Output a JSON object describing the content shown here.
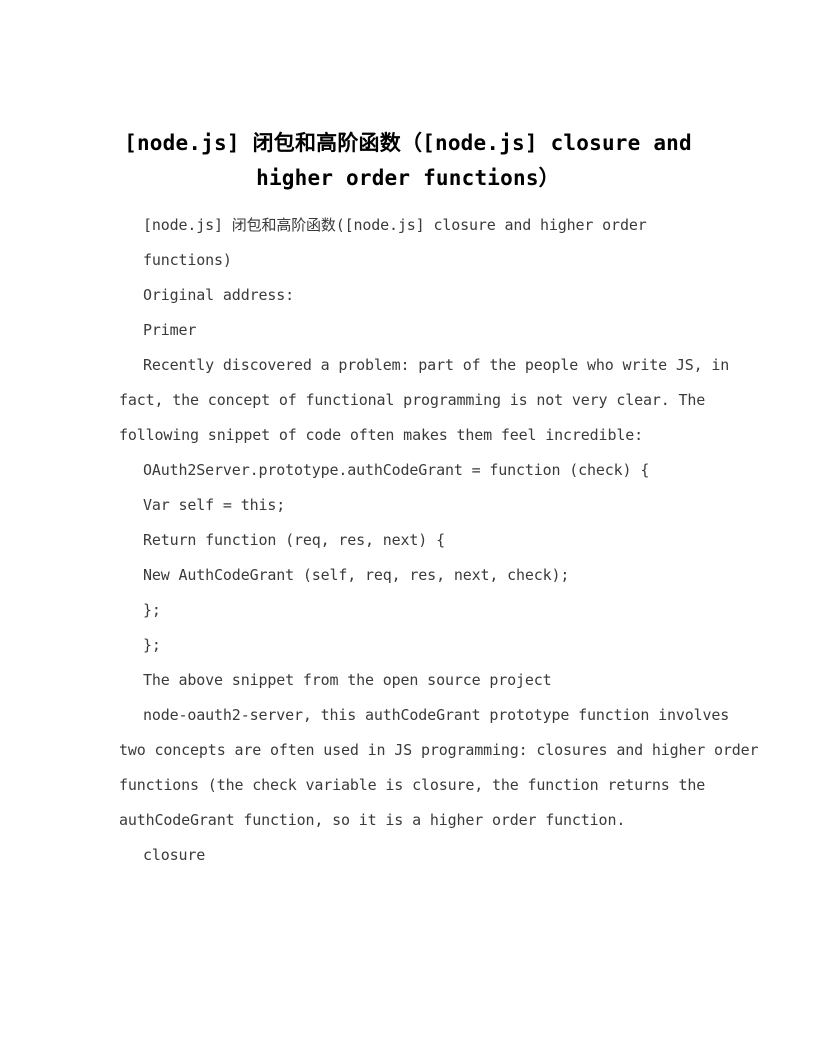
{
  "document": {
    "title_lines": [
      "[node.js] 闭包和高阶函数（[node.js] closure and",
      "higher order functions）"
    ],
    "body_lines": [
      {
        "text": "[node.js] 闭包和高阶函数([node.js] closure and higher order",
        "indent": true
      },
      {
        "text": "functions)",
        "indent": true
      },
      {
        "text": "Original address:",
        "indent": true
      },
      {
        "text": "Primer",
        "indent": true
      },
      {
        "text": "Recently discovered a problem: part of the people who write JS, in",
        "indent": true
      },
      {
        "text": "fact, the concept of functional programming is not very clear. The",
        "indent": false
      },
      {
        "text": "following snippet of code often makes them feel incredible:",
        "indent": false
      },
      {
        "text": "OAuth2Server.prototype.authCodeGrant = function (check) {",
        "indent": true
      },
      {
        "text": "Var self = this;",
        "indent": true
      },
      {
        "text": "Return function (req, res, next) {",
        "indent": true
      },
      {
        "text": "New AuthCodeGrant (self, req, res, next, check);",
        "indent": true
      },
      {
        "text": "};",
        "indent": true
      },
      {
        "text": "};",
        "indent": true
      },
      {
        "text": "The above snippet from the open source project",
        "indent": true
      },
      {
        "text": "node-oauth2-server, this authCodeGrant prototype function involves",
        "indent": true
      },
      {
        "text": "two concepts are often used in JS programming: closures and higher order",
        "indent": false
      },
      {
        "text": "functions (the check variable is closure, the function returns the",
        "indent": false
      },
      {
        "text": "authCodeGrant function, so it is a higher order function.",
        "indent": false
      },
      {
        "text": "closure",
        "indent": true
      }
    ]
  },
  "colors": {
    "page_background": "#ffffff",
    "title_text": "#000000",
    "body_text": "#3a3a3a"
  }
}
